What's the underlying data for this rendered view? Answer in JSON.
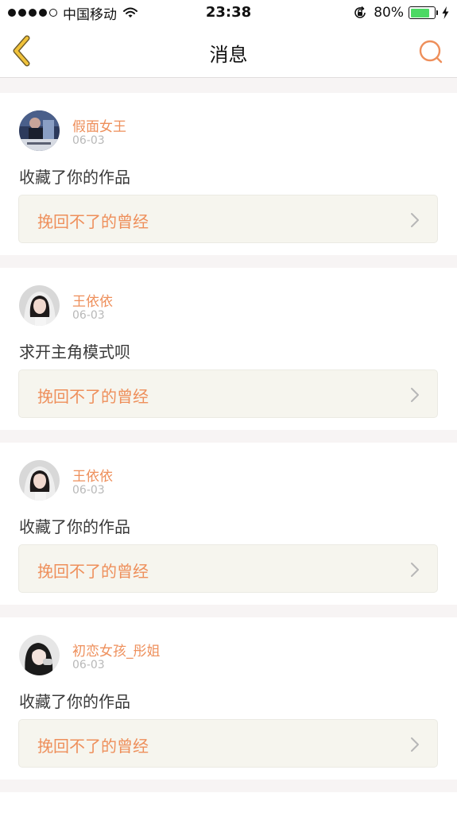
{
  "status_bar": {
    "carrier": "中国移动",
    "time": "23:38",
    "battery_percent": "80%",
    "battery_level": 0.8,
    "signal_bars_filled": 4,
    "signal_bars_total": 5
  },
  "nav": {
    "title": "消息",
    "back_icon": "chevron-left-icon",
    "search_icon": "search-icon"
  },
  "colors": {
    "accent": "#ee8f5b",
    "back_icon": "#f0c23a",
    "card_link_bg": "#f6f5ee",
    "page_bg": "#f7f4f4",
    "battery": "#4cd964"
  },
  "messages": [
    {
      "username": "假面女王",
      "date": "06-03",
      "text": "收藏了你的作品",
      "work_title": "挽回不了的曾经"
    },
    {
      "username": "王依依",
      "date": "06-03",
      "text": "求开主角模式呗",
      "work_title": "挽回不了的曾经"
    },
    {
      "username": "王依依",
      "date": "06-03",
      "text": "收藏了你的作品",
      "work_title": "挽回不了的曾经"
    },
    {
      "username": "初恋女孩_彤姐",
      "date": "06-03",
      "text": "收藏了你的作品",
      "work_title": "挽回不了的曾经"
    }
  ]
}
